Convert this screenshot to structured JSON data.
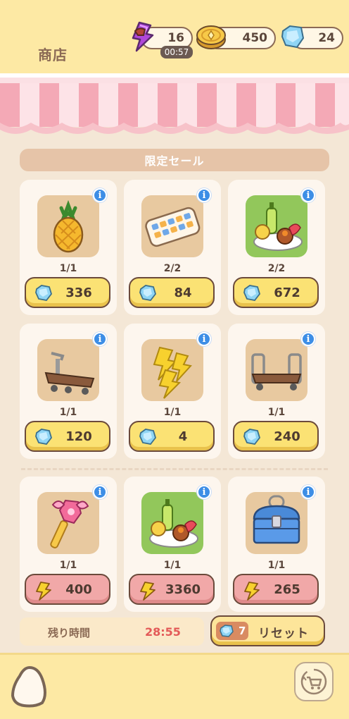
{
  "header": {
    "title": "商店",
    "energy": {
      "value": "16",
      "timer": "00:57",
      "icon": "lightning-icon"
    },
    "coins": {
      "value": "450",
      "icon": "coin-icon"
    },
    "gems": {
      "value": "24",
      "icon": "gem-icon"
    }
  },
  "sale": {
    "title": "限定セール",
    "items": [
      {
        "name": "pineapple",
        "count": "1/1",
        "currency": "gem",
        "price": "336"
      },
      {
        "name": "keyboard",
        "count": "2/2",
        "currency": "gem",
        "price": "84"
      },
      {
        "name": "drinks-platter",
        "count": "2/2",
        "currency": "gem",
        "price": "672"
      },
      {
        "name": "cart",
        "count": "1/1",
        "currency": "gem",
        "price": "120"
      },
      {
        "name": "energy-bolts",
        "count": "1/1",
        "currency": "gem",
        "price": "4"
      },
      {
        "name": "luggage-cart",
        "count": "1/1",
        "currency": "gem",
        "price": "240"
      },
      {
        "name": "magic-wand",
        "count": "1/1",
        "currency": "energy",
        "price": "400"
      },
      {
        "name": "drinks-platter",
        "count": "1/1",
        "currency": "energy",
        "price": "3360"
      },
      {
        "name": "treasure-chest",
        "count": "1/1",
        "currency": "energy",
        "price": "265"
      }
    ]
  },
  "footer": {
    "remaining_label": "残り時間",
    "remaining_time": "28:55",
    "reset_cost": "7",
    "reset_label": "リセット"
  },
  "colors": {
    "topbar": "#fde9a4",
    "background": "#f4e7d6",
    "gem_button": "#fbe274",
    "energy_button": "#f1a8a8",
    "info_icon": "#3d8ee6",
    "timer_text": "#e35a58"
  }
}
